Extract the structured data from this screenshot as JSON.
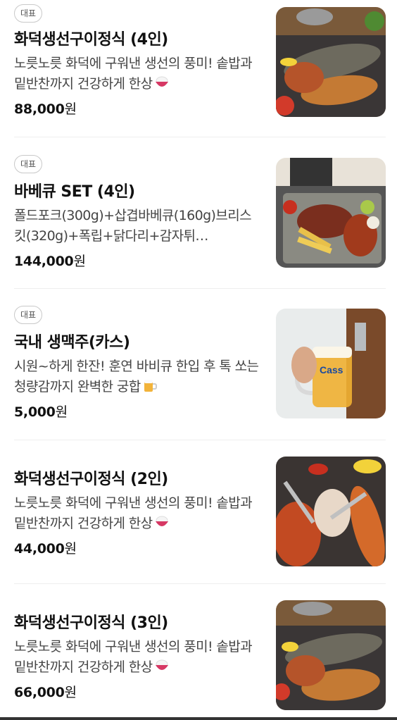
{
  "items": [
    {
      "badge": "대표",
      "title": "화덕생선구이정식 (4인)",
      "description": "노릇노릇 화덕에 구워낸 생선의 풍미! 솥밥과 밑반찬까지 건강하게 한상",
      "emoji_icon": "rice-bowl-icon",
      "price": "88,000",
      "currency": "원",
      "image": "grilled-fish-platter-image"
    },
    {
      "badge": "대표",
      "title": "바베큐 SET (4인)",
      "description": "폴드포크(300g)+삽겹바베큐(160g)브리스킷(320g)+폭립+닭다리+감자튀…",
      "price": "144,000",
      "currency": "원",
      "image": "bbq-platter-image"
    },
    {
      "badge": "대표",
      "title": "국내 생맥주(카스)",
      "description": "시원~하게 한잔! 훈연 바비큐 한입 후 톡 쏘는 청량감까지 완벽한 궁합",
      "emoji_icon": "beer-mug-icon",
      "price": "5,000",
      "currency": "원",
      "image": "draft-beer-image"
    },
    {
      "title": "화덕생선구이정식 (2인)",
      "description": "노릇노릇 화덕에 구워낸 생선의 풍미! 솥밥과 밑반찬까지 건강하게 한상",
      "emoji_icon": "rice-bowl-icon",
      "price": "44,000",
      "currency": "원",
      "image": "grilled-fish-tongs-image"
    },
    {
      "title": "화덕생선구이정식 (3인)",
      "description": "노릇노릇 화덕에 구워낸 생선의 풍미! 솥밥과 밑반찬까지 건강하게 한상",
      "emoji_icon": "rice-bowl-icon",
      "price": "66,000",
      "currency": "원",
      "image": "grilled-fish-platter-image"
    }
  ]
}
